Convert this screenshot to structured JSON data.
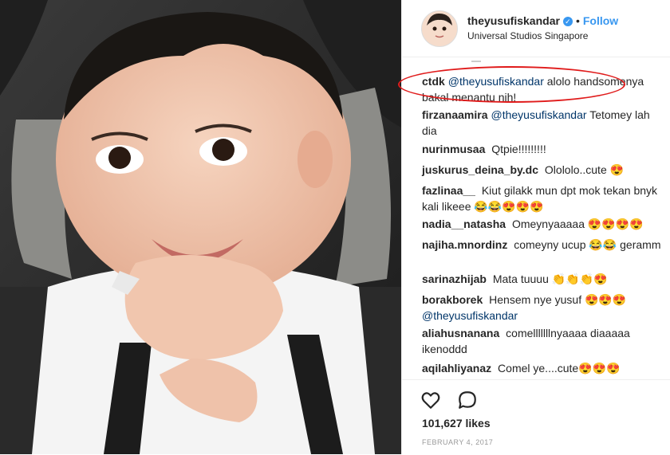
{
  "post": {
    "username": "theyusufiskandar",
    "follow_label": "Follow",
    "dot": "•",
    "verified_glyph": "✓",
    "location": "Universal Studios Singapore",
    "likes": "101,627 likes",
    "date": "FEBRUARY 4, 2017"
  },
  "comments": [
    {
      "user": "ctdk",
      "mention": "@theyusufiskandar",
      "text": "alolo handsomenya bakal menantu nih!"
    },
    {
      "user": "firzanaamira",
      "mention": "@theyusufiskandar",
      "text": "Tetomey lah dia"
    },
    {
      "user": "nurinmusaa",
      "mention": "",
      "text": "Qtpie!!!!!!!!!"
    },
    {
      "user": "juskurus_deina_by.dc",
      "mention": "",
      "text": "Olololo..cute 😍"
    },
    {
      "user": "fazlinaa__",
      "mention": "",
      "text": "Kiut gilakk mun dpt mok tekan bnyk kali likeee 😂😂😍😍😍"
    },
    {
      "user": "nadia__natasha",
      "mention": "",
      "text": "Omeynyaaaaa 😍😍😍😍"
    },
    {
      "user": "najiha.mnordinz",
      "mention": "",
      "text": "comeyny ucup 😂😂 geramm"
    },
    {
      "user": "sarinazhijab",
      "mention": "",
      "text": "Mata tuuuu 👏👏👏😍"
    },
    {
      "user": "borakborek",
      "mention": "@theyusufiskandar",
      "text": "Hensem nye yusuf 😍😍😍",
      "mention_after": true
    },
    {
      "user": "aliahusnanana",
      "mention": "",
      "text": "comelllllllnyaaaa diaaaaa ikenoddd"
    },
    {
      "user": "aqilahliyanaz",
      "mention": "",
      "text": "Comel ye....cute😍😍😍"
    }
  ],
  "icons": {
    "like": "heart-icon",
    "comment": "comment-icon"
  },
  "colors": {
    "link": "#3897f0",
    "mention": "#003569",
    "highlight": "#e01b1b"
  }
}
